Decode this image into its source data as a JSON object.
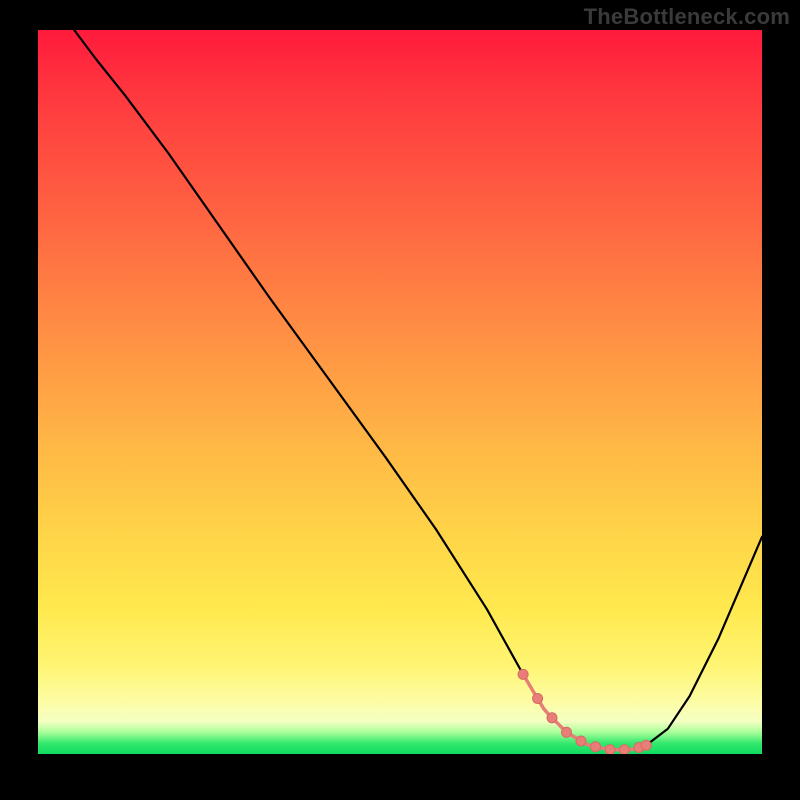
{
  "watermark": "TheBottleneck.com",
  "chart_data": {
    "type": "line",
    "title": "",
    "xlabel": "",
    "ylabel": "",
    "xlim": [
      0,
      100
    ],
    "ylim": [
      0,
      100
    ],
    "grid": false,
    "legend": false,
    "series": [
      {
        "name": "curve",
        "x": [
          5,
          8,
          12,
          18,
          25,
          32,
          40,
          48,
          55,
          62,
          67,
          70,
          73,
          76,
          79,
          82,
          84,
          87,
          90,
          94,
          100
        ],
        "y": [
          100,
          96,
          91,
          83,
          73,
          63,
          52,
          41,
          31,
          20,
          11,
          6,
          3,
          1.2,
          0.6,
          0.6,
          1.2,
          3.5,
          8,
          16,
          30
        ]
      }
    ],
    "highlight_range_x": [
      67,
      84
    ],
    "highlight_points_x": [
      67,
      69,
      71,
      73,
      75,
      77,
      79,
      81,
      83,
      84
    ],
    "background_gradient": {
      "type": "vertical",
      "stops": [
        {
          "pos": 0.0,
          "color": "#ff1a3c"
        },
        {
          "pos": 0.7,
          "color": "#ffd548"
        },
        {
          "pos": 0.93,
          "color": "#fdfda8"
        },
        {
          "pos": 1.0,
          "color": "#0fdb62"
        }
      ]
    }
  }
}
